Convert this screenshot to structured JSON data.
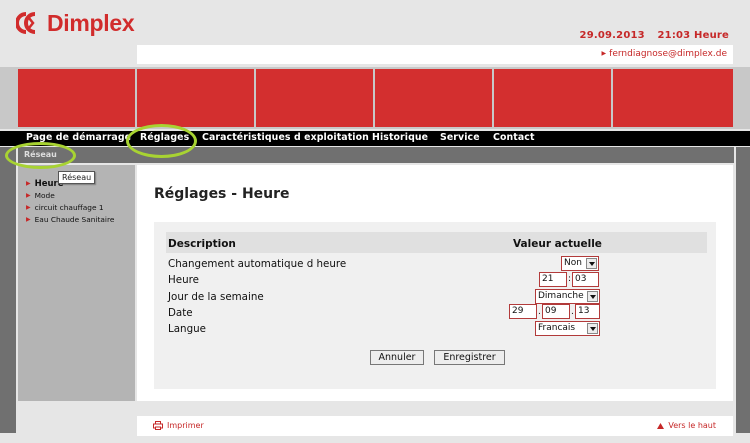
{
  "brand": {
    "name": "Dimplex",
    "color": "#d12c2c",
    "logo_icon": "dimplex-logo-icon"
  },
  "header": {
    "date": "29.09.2013",
    "time": "21:03 Heure",
    "user_email": "ferndiagnose@dimplex.de"
  },
  "nav": {
    "items": [
      {
        "label": "Page de démarrage"
      },
      {
        "label": "Réglages"
      },
      {
        "label": "Caractéristiques d exploitation"
      },
      {
        "label": "Historique"
      },
      {
        "label": "Service"
      },
      {
        "label": "Contact"
      }
    ]
  },
  "subnav": {
    "items": [
      {
        "label": "Réseau"
      }
    ]
  },
  "tooltip": {
    "text": "Réseau"
  },
  "sidebar": {
    "items": [
      {
        "label": "Heure"
      },
      {
        "label": "Mode"
      },
      {
        "label": "circuit chauffage 1"
      },
      {
        "label": "Eau Chaude Sanitaire"
      }
    ]
  },
  "page": {
    "title": "Réglages - Heure"
  },
  "table": {
    "col_description": "Description",
    "col_value": "Valeur actuelle",
    "rows": [
      {
        "label": "Changement automatique d heure",
        "value": "Non"
      },
      {
        "label": "Heure",
        "hours": "21",
        "separator": ":",
        "minutes": "03"
      },
      {
        "label": "Jour de la semaine",
        "value": "Dimanche"
      },
      {
        "label": "Date",
        "day": "29",
        "month": "09",
        "year": "13",
        "separator": "."
      },
      {
        "label": "Langue",
        "value": "Francais"
      }
    ]
  },
  "buttons": {
    "cancel": "Annuler",
    "save": "Enregistrer"
  },
  "footer": {
    "print": "Imprimer",
    "top": "Vers le haut"
  },
  "colors": {
    "red": "#d32f2f",
    "highlight": "#a8d332",
    "nav_bg": "#000000"
  }
}
